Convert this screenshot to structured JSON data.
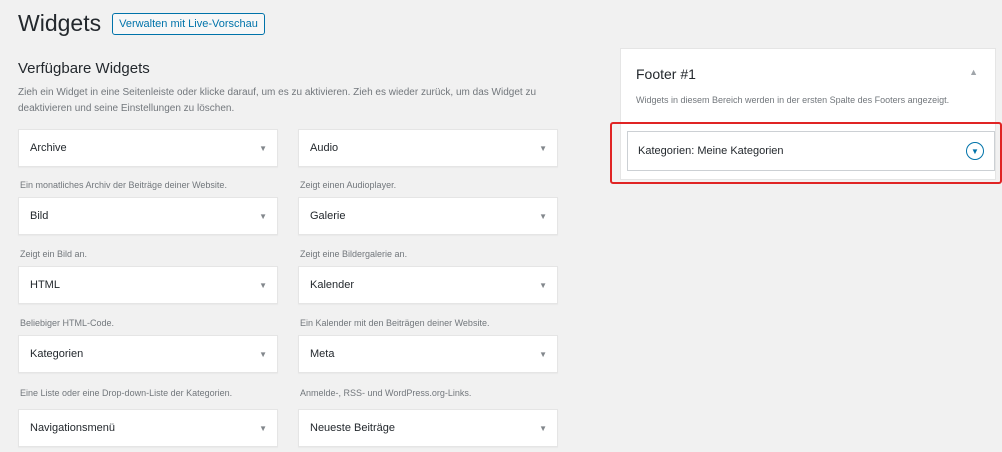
{
  "header": {
    "title": "Widgets",
    "live_preview_button": "Verwalten mit Live-Vorschau"
  },
  "available": {
    "title": "Verfügbare Widgets",
    "description": "Zieh ein Widget in eine Seitenleiste oder klicke darauf, um es zu aktivieren. Zieh es wieder zurück, um das Widget zu deaktivieren und seine Einstellungen zu löschen.",
    "widgets": [
      {
        "name": "Archive",
        "desc": "Ein monatliches Archiv der Beiträge deiner Website."
      },
      {
        "name": "Audio",
        "desc": "Zeigt einen Audioplayer."
      },
      {
        "name": "Bild",
        "desc": "Zeigt ein Bild an."
      },
      {
        "name": "Galerie",
        "desc": "Zeigt eine Bildergalerie an."
      },
      {
        "name": "HTML",
        "desc": "Beliebiger HTML-Code."
      },
      {
        "name": "Kalender",
        "desc": "Ein Kalender mit den Beiträgen deiner Website."
      },
      {
        "name": "Kategorien",
        "desc": "Eine Liste oder eine Drop-down-Liste der Kategorien."
      },
      {
        "name": "Meta",
        "desc": "Anmelde-, RSS- und WordPress.org-Links."
      },
      {
        "name": "Navigationsmenü",
        "desc": ""
      },
      {
        "name": "Neueste Beiträge",
        "desc": ""
      }
    ]
  },
  "sidebar": {
    "title": "Footer #1",
    "description": "Widgets in diesem Bereich werden in der ersten Spalte des Footers angezeigt.",
    "assigned_widget": "Kategorien: Meine Kategorien"
  }
}
